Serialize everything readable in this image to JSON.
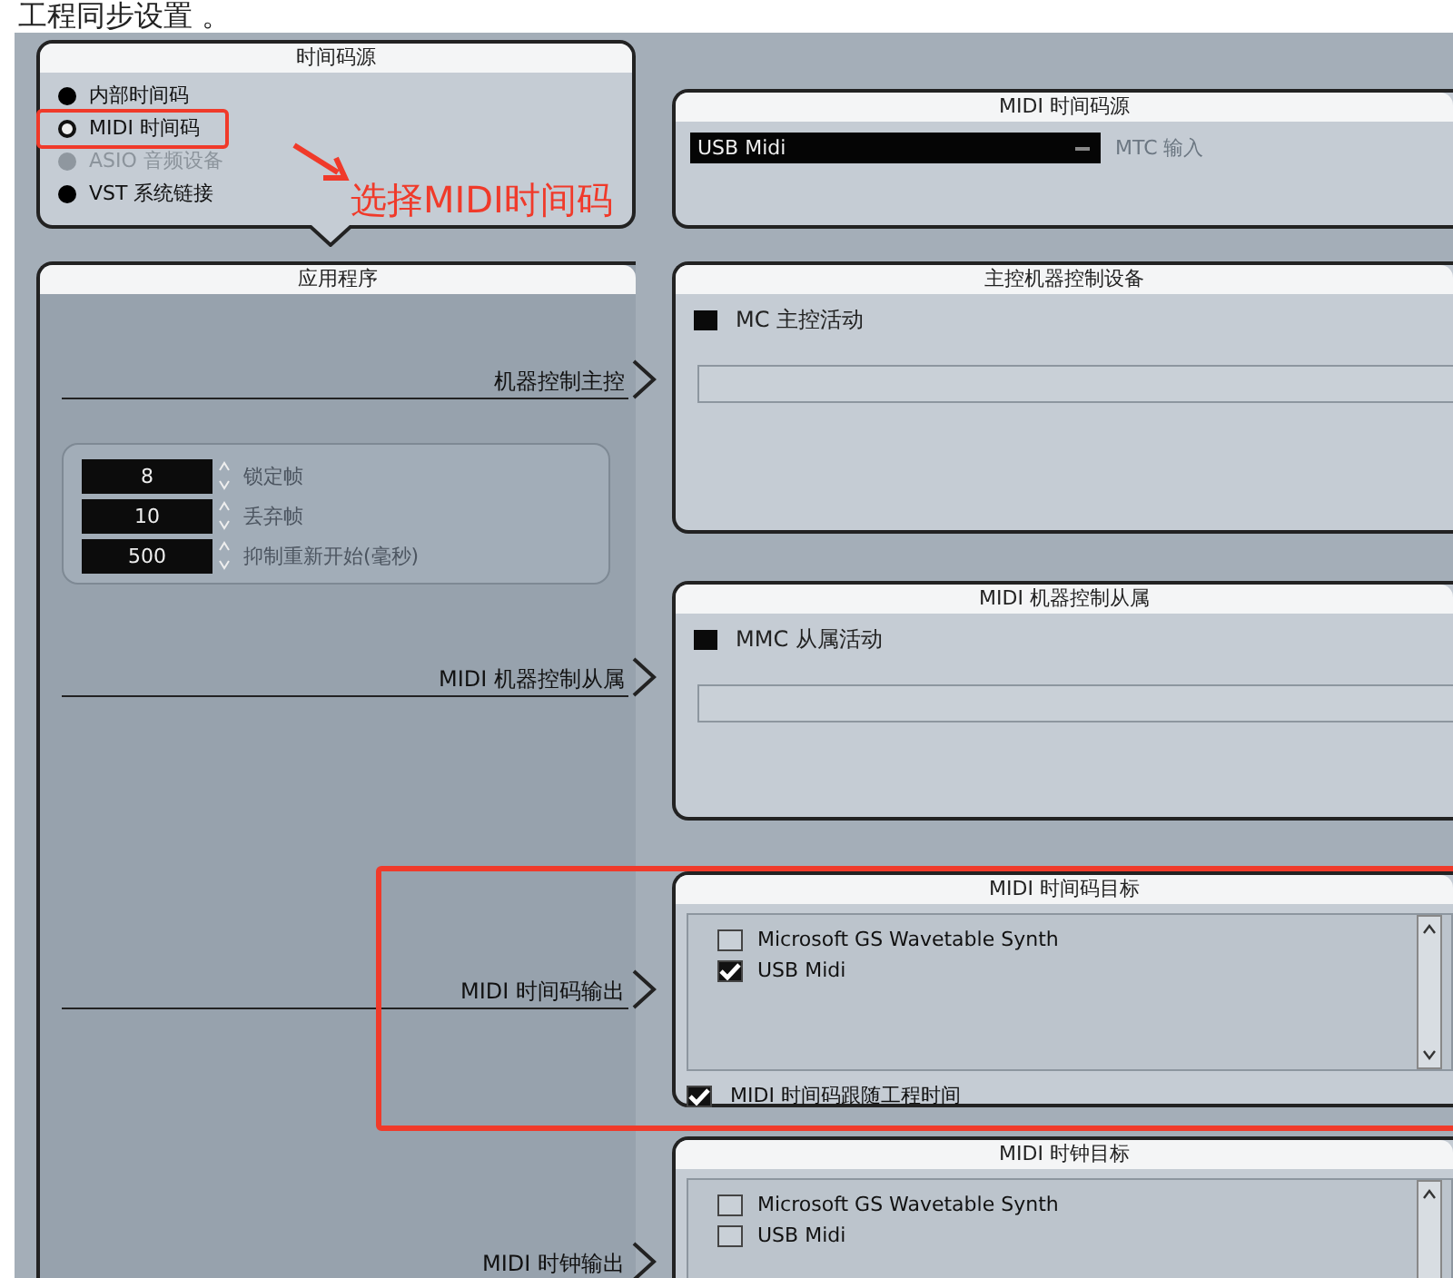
{
  "caption": "工程同步设置 。",
  "timecode_source": {
    "title": "时间码源",
    "options": [
      {
        "label": "内部时间码",
        "selected": false,
        "disabled": false
      },
      {
        "label": "MIDI 时间码",
        "selected": true,
        "disabled": false
      },
      {
        "label": "ASIO 音频设备",
        "selected": false,
        "disabled": true
      },
      {
        "label": "VST 系统链接",
        "selected": false,
        "disabled": false
      }
    ]
  },
  "annotation": {
    "text": "选择MIDI时间码"
  },
  "midi_timecode_source": {
    "title": "MIDI 时间码源",
    "device": "USB Midi",
    "label": "MTC 输入"
  },
  "application": {
    "title": "应用程序",
    "outputs": [
      "机器控制主控",
      "MIDI 机器控制从属",
      "MIDI 时间码输出",
      "MIDI 时钟输出"
    ],
    "spinners": [
      {
        "value": "8",
        "label": "锁定帧"
      },
      {
        "value": "10",
        "label": "丢弃帧"
      },
      {
        "value": "500",
        "label": "抑制重新开始(毫秒)"
      }
    ]
  },
  "machine_control_master": {
    "title": "主控机器控制设备",
    "toggle": {
      "label": "MC 主控活动",
      "checked": false
    }
  },
  "midi_machine_control_slave": {
    "title": "MIDI 机器控制从属",
    "toggle": {
      "label": "MMC 从属活动",
      "checked": false
    }
  },
  "midi_timecode_targets": {
    "title": "MIDI 时间码目标",
    "devices": [
      {
        "label": "Microsoft GS Wavetable Synth",
        "checked": false
      },
      {
        "label": "USB Midi",
        "checked": true
      }
    ],
    "follow": {
      "label": "MIDI 时间码跟随工程时间",
      "checked": true
    }
  },
  "midi_clock_targets": {
    "title": "MIDI 时钟目标",
    "devices": [
      {
        "label": "Microsoft GS Wavetable Synth",
        "checked": false
      },
      {
        "label": "USB Midi",
        "checked": false
      }
    ]
  }
}
